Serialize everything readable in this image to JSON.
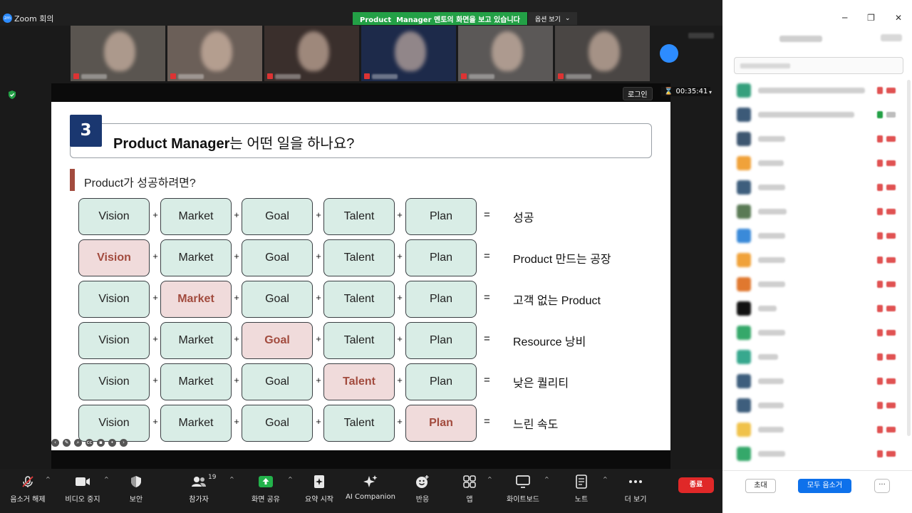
{
  "window": {
    "app_title": "Zoom 회의",
    "logo_text": "zm",
    "controls": [
      "─",
      "❐",
      "✕"
    ]
  },
  "share_banner": {
    "text": "Product  Manager 멘토의 화면을 보고 있습니다",
    "options_label": "옵션 보기",
    "options_caret": "⌄"
  },
  "video_tiles": [
    {
      "bg": "#5a5550"
    },
    {
      "bg": "#6b5f58"
    },
    {
      "bg": "#3a2f2c"
    },
    {
      "bg": "#1d2a4a"
    },
    {
      "bg": "#5b5857"
    },
    {
      "bg": "#4a4644"
    }
  ],
  "share_controls": {
    "login_label": "로그인",
    "timer_icon": "⌛",
    "timer": "00:35:41",
    "timer_caret": "▾"
  },
  "slide": {
    "number": "3",
    "title_bold": "Product Manager",
    "title_rest": "는 어떤 일을 하나요?",
    "subtitle": "Product가 성공하려면?",
    "plus": "+",
    "equals": "=",
    "rows": [
      {
        "cells": [
          "Vision",
          "Market",
          "Goal",
          "Talent",
          "Plan"
        ],
        "bad": -1,
        "result": "성공"
      },
      {
        "cells": [
          "Vision",
          "Market",
          "Goal",
          "Talent",
          "Plan"
        ],
        "bad": 0,
        "result": "Product 만드는 공장"
      },
      {
        "cells": [
          "Vision",
          "Market",
          "Goal",
          "Talent",
          "Plan"
        ],
        "bad": 1,
        "result": "고객 없는 Product"
      },
      {
        "cells": [
          "Vision",
          "Market",
          "Goal",
          "Talent",
          "Plan"
        ],
        "bad": 2,
        "result": "Resource 낭비"
      },
      {
        "cells": [
          "Vision",
          "Market",
          "Goal",
          "Talent",
          "Plan"
        ],
        "bad": 3,
        "result": "낮은 퀄리티"
      },
      {
        "cells": [
          "Vision",
          "Market",
          "Goal",
          "Talent",
          "Plan"
        ],
        "bad": 4,
        "result": "느린 속도"
      }
    ],
    "nav_icons": [
      "prev-icon",
      "pen-icon",
      "zoom-icon",
      "captions-icon",
      "video-icon",
      "more-icon",
      "next-icon"
    ]
  },
  "participants_panel": {
    "participants": [
      {
        "avatar": "#35a07d",
        "mic": "muted",
        "cam": "off"
      },
      {
        "avatar": "#3c5a78",
        "mic": "active",
        "cam": "on"
      },
      {
        "avatar": "#3d5670",
        "mic": "muted",
        "cam": "off"
      },
      {
        "avatar": "#f0a23a",
        "mic": "muted",
        "cam": "off"
      },
      {
        "avatar": "#3e5e7d",
        "mic": "muted",
        "cam": "off"
      },
      {
        "avatar": "#5a7a55",
        "mic": "muted",
        "cam": "off"
      },
      {
        "avatar": "#3a8ad9",
        "mic": "muted",
        "cam": "off"
      },
      {
        "avatar": "#f0a23a",
        "mic": "muted",
        "cam": "off"
      },
      {
        "avatar": "#e0782f",
        "mic": "muted",
        "cam": "off"
      },
      {
        "avatar": "#111111",
        "mic": "muted",
        "cam": "off"
      },
      {
        "avatar": "#35a86a",
        "mic": "muted",
        "cam": "off"
      },
      {
        "avatar": "#37a88e",
        "mic": "muted",
        "cam": "off"
      },
      {
        "avatar": "#3e5e7d",
        "mic": "muted",
        "cam": "off"
      },
      {
        "avatar": "#3e5e7d",
        "mic": "muted",
        "cam": "off"
      },
      {
        "avatar": "#f0c24a",
        "mic": "muted",
        "cam": "off"
      },
      {
        "avatar": "#35a86a",
        "mic": "muted",
        "cam": "off"
      }
    ],
    "invite_label": "초대",
    "mute_all_label": "모두 음소거",
    "more_label": "···"
  },
  "toolbar": {
    "participant_count": "19",
    "end_label": "종료",
    "items": [
      {
        "name": "unmute",
        "label": "음소거 해제",
        "icon": "mic-muted-icon"
      },
      {
        "name": "stop-video",
        "label": "비디오 중지",
        "icon": "video-camera-icon"
      },
      {
        "name": "security",
        "label": "보안",
        "icon": "shield-icon"
      },
      {
        "name": "participants",
        "label": "참가자",
        "icon": "participants-icon"
      },
      {
        "name": "share-screen",
        "label": "화면 공유",
        "icon": "share-screen-icon"
      },
      {
        "name": "summary",
        "label": "요약 시작",
        "icon": "summary-icon"
      },
      {
        "name": "ai-companion",
        "label": "AI Companion",
        "icon": "ai-sparkle-icon"
      },
      {
        "name": "reactions",
        "label": "반응",
        "icon": "reaction-icon"
      },
      {
        "name": "apps",
        "label": "앱",
        "icon": "apps-icon"
      },
      {
        "name": "whiteboard",
        "label": "화이트보드",
        "icon": "whiteboard-icon"
      },
      {
        "name": "notes",
        "label": "노트",
        "icon": "notes-icon"
      },
      {
        "name": "more",
        "label": "더 보기",
        "icon": "more-dots-icon"
      }
    ]
  },
  "colors": {
    "zoom_blue": "#0e71eb",
    "share_green": "#23a046",
    "end_red": "#e02828",
    "slide_navy": "#1a3770",
    "cell_green": "#d9ede6",
    "cell_bad": "#f0dbdb",
    "accent_red": "#a24b3e"
  }
}
